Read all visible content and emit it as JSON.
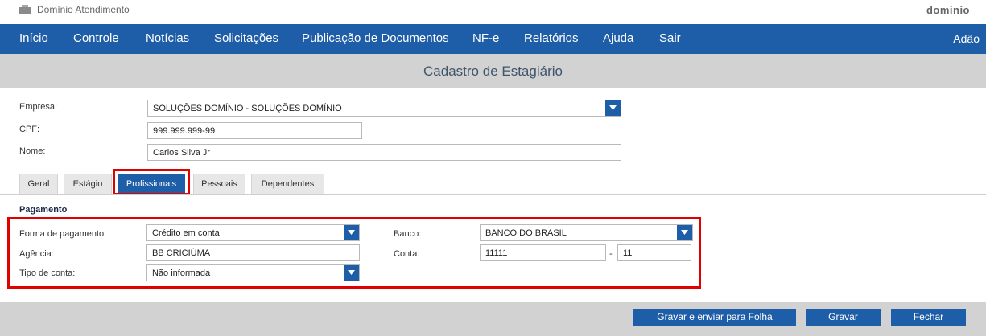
{
  "app": {
    "title": "Domínio Atendimento",
    "brand": "dominio"
  },
  "nav": {
    "items": [
      {
        "label": "Início"
      },
      {
        "label": "Controle"
      },
      {
        "label": "Notícias"
      },
      {
        "label": "Solicitações"
      },
      {
        "label": "Publicação de Documentos"
      },
      {
        "label": "NF-e"
      },
      {
        "label": "Relatórios"
      },
      {
        "label": "Ajuda"
      },
      {
        "label": "Sair"
      }
    ],
    "user": "Adão"
  },
  "page": {
    "title": "Cadastro de Estagiário"
  },
  "header_form": {
    "empresa_label": "Empresa:",
    "empresa_value": "SOLUÇÕES DOMÍNIO - SOLUÇÕES DOMÍNIO",
    "cpf_label": "CPF:",
    "cpf_value": "999.999.999-99",
    "nome_label": "Nome:",
    "nome_value": "Carlos Silva Jr"
  },
  "tabs": [
    {
      "label": "Geral"
    },
    {
      "label": "Estágio"
    },
    {
      "label": "Profissionais",
      "active": true
    },
    {
      "label": "Pessoais"
    },
    {
      "label": "Dependentes"
    }
  ],
  "pagamento": {
    "section_title": "Pagamento",
    "forma_label": "Forma de pagamento:",
    "forma_value": "Crédito em conta",
    "agencia_label": "Agência:",
    "agencia_value": "BB CRICIÚMA",
    "tipo_label": "Tipo de conta:",
    "tipo_value": "Não informada",
    "banco_label": "Banco:",
    "banco_value": "BANCO DO BRASIL",
    "conta_label": "Conta:",
    "conta_value": "11111",
    "conta_sep": "-",
    "conta_digit": "11"
  },
  "footer": {
    "save_send_label": "Gravar e enviar para Folha",
    "save_label": "Gravar",
    "close_label": "Fechar"
  },
  "colors": {
    "primary": "#1e5da7",
    "highlight": "#e00000",
    "band": "#d2d2d2"
  }
}
